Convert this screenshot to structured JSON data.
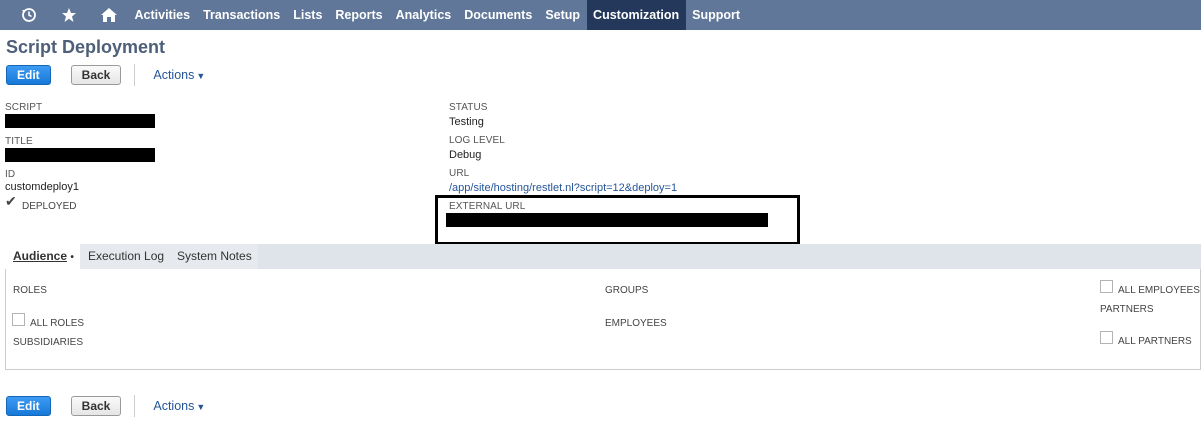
{
  "nav": {
    "items": [
      "Activities",
      "Transactions",
      "Lists",
      "Reports",
      "Analytics",
      "Documents",
      "Setup",
      "Customization",
      "Support"
    ],
    "active": "Customization",
    "icons": [
      "recent-records-icon",
      "star-icon",
      "home-icon"
    ]
  },
  "page": {
    "title": "Script Deployment"
  },
  "toolbar": {
    "edit": "Edit",
    "back": "Back",
    "actions": "Actions"
  },
  "fields": {
    "script_label": "SCRIPT",
    "title_label": "TITLE",
    "id_label": "ID",
    "id_value": "customdeploy1",
    "deployed_label": "DEPLOYED",
    "deployed_checked": true,
    "status_label": "STATUS",
    "status_value": "Testing",
    "log_level_label": "LOG LEVEL",
    "log_level_value": "Debug",
    "url_label": "URL",
    "url_value": "/app/site/hosting/restlet.nl?script=12&deploy=1",
    "external_url_label": "EXTERNAL URL"
  },
  "tabs": {
    "audience": "Audience",
    "audience_marker": "•",
    "execution_log": "Execution Log",
    "system_notes": "System Notes"
  },
  "audience": {
    "roles_label": "ROLES",
    "all_roles_label": "ALL ROLES",
    "subsidiaries_label": "SUBSIDIARIES",
    "groups_label": "GROUPS",
    "employees_label": "EMPLOYEES",
    "all_employees_label": "ALL EMPLOYEES",
    "partners_label": "PARTNERS",
    "all_partners_label": "ALL PARTNERS"
  },
  "colors": {
    "nav_bg": "#607799",
    "nav_active": "#24385b",
    "primary_button": "#1779d7",
    "link": "#255599",
    "title": "#4d5f79"
  }
}
